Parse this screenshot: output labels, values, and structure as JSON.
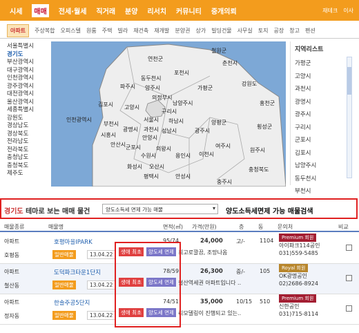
{
  "top_nav": {
    "items": [
      "시세",
      "매매",
      "전세·월세",
      "직거래",
      "분양",
      "리서치",
      "커뮤니티",
      "중개의뢰"
    ],
    "active": "매매",
    "right": [
      "재테크",
      "이사"
    ]
  },
  "sub_nav": {
    "items": [
      "아파트",
      "주상복합",
      "오피스텔",
      "원룸",
      "주택",
      "빌라",
      "재건축",
      "재개발",
      "분양권",
      "상가",
      "빌딩건물",
      "사무실",
      "토지",
      "공장",
      "창고",
      "펜션"
    ],
    "active": "아파트"
  },
  "regions": {
    "items": [
      "서울특별시",
      "경기도",
      "부산광역시",
      "대구광역시",
      "인천광역시",
      "광주광역시",
      "대전광역시",
      "울산광역시",
      "세종특별시",
      "강원도",
      "경상남도",
      "경상북도",
      "전라남도",
      "전라북도",
      "충청남도",
      "충청북도",
      "제주도"
    ],
    "active": "경기도"
  },
  "map_labels": [
    "철원군",
    "연천군",
    "포천시",
    "춘천시",
    "동두천시",
    "파주시",
    "양주시",
    "가평군",
    "강원도",
    "의정부시",
    "남양주시",
    "김포시",
    "고양시",
    "구리시",
    "홍천군",
    "인천광역시",
    "하남시",
    "부천시",
    "서울시",
    "광명시",
    "과천시",
    "양평군",
    "시흥시",
    "성남시",
    "광주시",
    "안산시",
    "안양시",
    "의왕시",
    "군포시",
    "수원시",
    "용인시",
    "이천시",
    "여주시",
    "횡성군",
    "화성시",
    "오산시",
    "원주시",
    "평택시",
    "안성시",
    "충주시",
    "충청북도"
  ],
  "region_list": {
    "header": "지역리스트",
    "items": [
      "가평군",
      "고양시",
      "과천시",
      "광명시",
      "광주시",
      "구리시",
      "군포시",
      "김포시",
      "남양주시",
      "동두천시",
      "부천시"
    ]
  },
  "search": {
    "region": "경기도",
    "lead": "테마로 보는 매매 물건",
    "select_value": "양도소득세 면제 가능 매물",
    "caption": "양도소득세면제 가능 매물검색"
  },
  "table": {
    "headers": [
      "매물종류",
      "매물명",
      "면적(㎡)",
      "가격(만원)",
      "층",
      "동",
      "문의처",
      "비교"
    ],
    "rows": [
      {
        "type": "아파트",
        "dong": "호평동",
        "name": "호평마을IPARK",
        "area": "95/74",
        "price": "24,000",
        "floor": "고/-",
        "bldg": "1104",
        "badge": "Premium 회원",
        "agency": "아이파크114공인",
        "phone": "031)559-5485",
        "sale_tag": "일반매물",
        "date": "13.04.22",
        "tag_first": "생애 최초",
        "tag_tax": "양도세 면제",
        "desc": "최고로깔끔, 조망나옴"
      },
      {
        "type": "아파트",
        "dong": "철산동",
        "name": "도덕파크타운1단지",
        "area": "78/59",
        "price": "26,300",
        "floor": "중/-",
        "bldg": "105",
        "badge": "Royal 회원",
        "agency": "OK광명공인",
        "phone": "02)2686-8924",
        "sale_tag": "일반매물",
        "date": "13.04.22",
        "tag_first": "생애 최초",
        "tag_tax": "양도세 면제",
        "desc": "철산역세권 아파트입니다 .."
      },
      {
        "type": "아파트",
        "dong": "정자동",
        "name": "한솔주공5단지",
        "area": "74/51",
        "price": "35,000",
        "floor": "10/15",
        "bldg": "510",
        "badge": "Premium 회원",
        "agency": "신한공인",
        "phone": "031)715-8114",
        "sale_tag": "일반매물",
        "date": "13.04.22",
        "tag_first": "생애 최초",
        "tag_tax": "양도세 면제",
        "desc": "리모델링이 진행되고 있는.."
      }
    ]
  },
  "colors": {
    "nav_orange": "#f39c1d",
    "map_sea": "#7da8d6",
    "link_blue": "#1f5fae",
    "highlight_red": "#e02020",
    "tag_purple": "#7b76c8"
  }
}
